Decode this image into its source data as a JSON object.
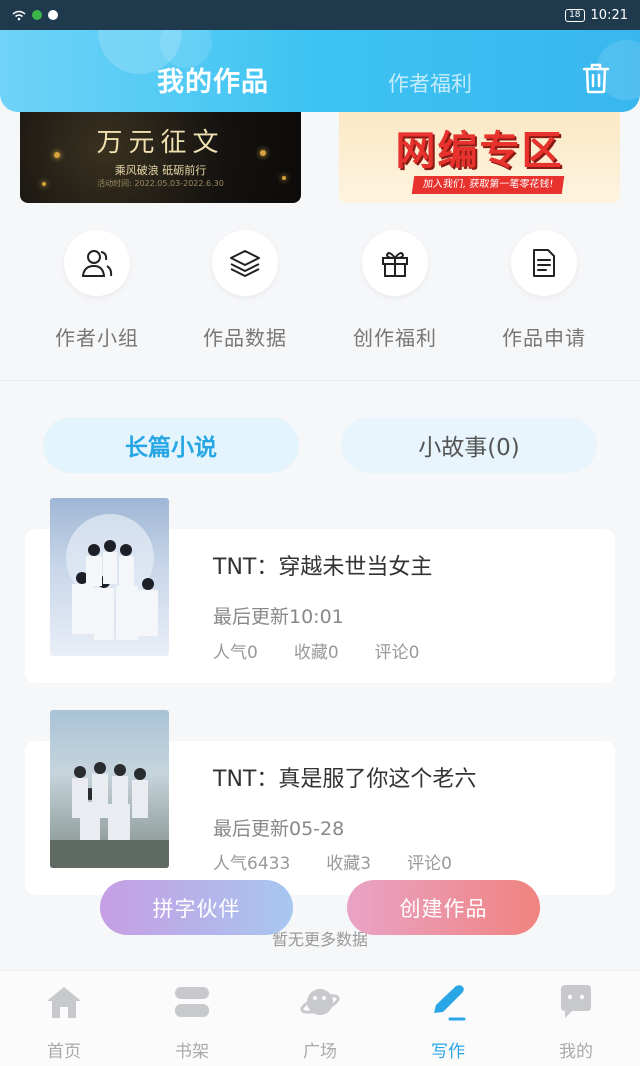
{
  "status_bar": {
    "time": "10:21",
    "battery": "18"
  },
  "header": {
    "tabs": [
      {
        "label": "我的作品",
        "active": true
      },
      {
        "label": "作者福利",
        "active": false
      }
    ],
    "trash_icon": "trash-icon"
  },
  "banners": [
    {
      "title": "万元征文",
      "subtitle": "乘风破浪 砥砺前行",
      "dates": "活动时间: 2022.05.03-2022.6.30"
    },
    {
      "title": "网编专区",
      "strip": "加入我们, 获取第一笔零花钱!"
    }
  ],
  "quick_actions": [
    {
      "label": "作者小组",
      "icon": "users-icon"
    },
    {
      "label": "作品数据",
      "icon": "layers-icon"
    },
    {
      "label": "创作福利",
      "icon": "gift-icon"
    },
    {
      "label": "作品申请",
      "icon": "document-icon"
    }
  ],
  "segments": [
    {
      "label": "长篇小说",
      "active": true
    },
    {
      "label": "小故事(0)",
      "active": false
    }
  ],
  "works": [
    {
      "title": "TNT：穿越未世当女主",
      "updated": "最后更新10:01",
      "popularity": "人气0",
      "favorites": "收藏0",
      "comments": "评论0"
    },
    {
      "title": "TNT：真是服了你这个老六",
      "updated": "最后更新05-28",
      "popularity": "人气6433",
      "favorites": "收藏3",
      "comments": "评论0"
    }
  ],
  "buttons": {
    "partner": "拼字伙伴",
    "create": "创建作品"
  },
  "no_more": "暂无更多数据",
  "tab_bar": [
    {
      "label": "首页",
      "icon": "home-icon",
      "active": false
    },
    {
      "label": "书架",
      "icon": "bookshelf-icon",
      "active": false
    },
    {
      "label": "广场",
      "icon": "planet-icon",
      "active": false
    },
    {
      "label": "写作",
      "icon": "pen-icon",
      "active": true
    },
    {
      "label": "我的",
      "icon": "chat-face-icon",
      "active": false
    }
  ],
  "colors": {
    "accent": "#2aa6e6",
    "header": "#3cc3f2"
  }
}
